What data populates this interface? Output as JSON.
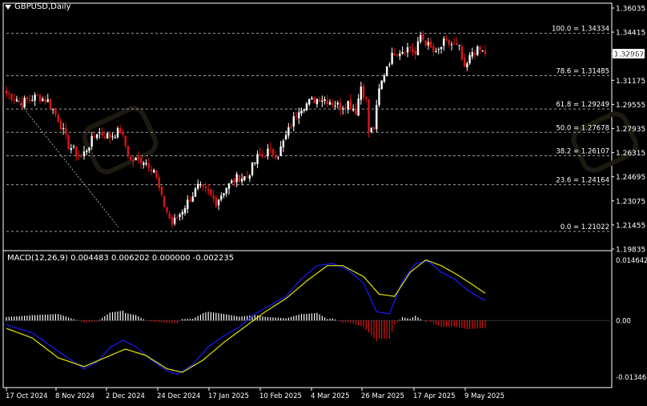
{
  "window": {
    "title": "GBPUSD,Daily"
  },
  "colors": {
    "background": "#000000",
    "bull_candle": "#ffffff",
    "bear_candle": "#e01515",
    "macd_hist_pos": "#ffffff",
    "macd_hist_neg": "#e01515",
    "macd_line": "#1a1aff",
    "signal_line": "#e5e500",
    "fib_line": "#a0a0a0",
    "axis_text": "#ffffff",
    "price_tag_bg": "#ffffff",
    "price_tag_text": "#000000"
  },
  "price_axis": {
    "labels": [
      "1.36035",
      "1.34415",
      "1.32967",
      "1.31175",
      "1.29555",
      "1.27935",
      "1.26315",
      "1.24695",
      "1.23075",
      "1.21455",
      "1.19835"
    ],
    "current_price": "1.32967"
  },
  "fibonacci": {
    "levels": [
      {
        "label": "100.0 = 1.34334",
        "price": 1.34334
      },
      {
        "label": "78.6 = 1.31485",
        "price": 1.31485
      },
      {
        "label": "61.8 = 1.29249",
        "price": 1.29249
      },
      {
        "label": "50.0 = 1.27678",
        "price": 1.27678
      },
      {
        "label": "38.2 = 1.26107",
        "price": 1.26107
      },
      {
        "label": "23.6 = 1.24164",
        "price": 1.24164
      },
      {
        "label": "0.0 = 1.21022",
        "price": 1.21022
      }
    ]
  },
  "macd": {
    "title": "MACD(12,26,9) 0.004483 0.006202 0.000000 -0.002235",
    "axis_labels": [
      "0.014642",
      "0.00",
      "-0.013461"
    ]
  },
  "time_axis": {
    "labels": [
      "17 Oct 2024",
      "8 Nov 2024",
      "2 Dec 2024",
      "24 Dec 2024",
      "17 Jan 2025",
      "10 Feb 2025",
      "4 Mar 2025",
      "26 Mar 2025",
      "17 Apr 2025",
      "9 May 2025"
    ]
  },
  "chart_data": {
    "type": "candlestick",
    "symbol": "GBPUSD",
    "timeframe": "Daily",
    "ylim": [
      1.19835,
      1.36035
    ],
    "close_anchors": [
      [
        0,
        1.303
      ],
      [
        6,
        1.297
      ],
      [
        12,
        1.301
      ],
      [
        16,
        1.298
      ],
      [
        20,
        1.286
      ],
      [
        24,
        1.268
      ],
      [
        29,
        1.26
      ],
      [
        35,
        1.277
      ],
      [
        40,
        1.274
      ],
      [
        44,
        1.278
      ],
      [
        48,
        1.258
      ],
      [
        53,
        1.258
      ],
      [
        57,
        1.252
      ],
      [
        60,
        1.232
      ],
      [
        64,
        1.215
      ],
      [
        67,
        1.222
      ],
      [
        70,
        1.23
      ],
      [
        74,
        1.24
      ],
      [
        78,
        1.236
      ],
      [
        81,
        1.23
      ],
      [
        85,
        1.24
      ],
      [
        89,
        1.246
      ],
      [
        93,
        1.247
      ],
      [
        97,
        1.26
      ],
      [
        101,
        1.264
      ],
      [
        105,
        1.262
      ],
      [
        109,
        1.278
      ],
      [
        113,
        1.293
      ],
      [
        117,
        1.297
      ],
      [
        121,
        1.3
      ],
      [
        125,
        1.298
      ],
      [
        129,
        1.294
      ],
      [
        132,
        1.297
      ],
      [
        135,
        1.291
      ],
      [
        137,
        1.308
      ],
      [
        139,
        1.298
      ],
      [
        140,
        1.277
      ],
      [
        142,
        1.28
      ],
      [
        144,
        1.305
      ],
      [
        147,
        1.322
      ],
      [
        150,
        1.331
      ],
      [
        153,
        1.332
      ],
      [
        156,
        1.334
      ],
      [
        158,
        1.329
      ],
      [
        160,
        1.342
      ],
      [
        163,
        1.335
      ],
      [
        166,
        1.329
      ],
      [
        169,
        1.337
      ],
      [
        172,
        1.336
      ],
      [
        175,
        1.333
      ],
      [
        177,
        1.318
      ],
      [
        180,
        1.331
      ],
      [
        183,
        1.332
      ],
      [
        185,
        1.33
      ]
    ],
    "macd_line_anchors": [
      [
        0,
        -0.001
      ],
      [
        10,
        -0.0028
      ],
      [
        20,
        -0.007
      ],
      [
        30,
        -0.011
      ],
      [
        35,
        -0.0095
      ],
      [
        40,
        -0.0062
      ],
      [
        45,
        -0.0045
      ],
      [
        50,
        -0.006
      ],
      [
        56,
        -0.009
      ],
      [
        62,
        -0.0115
      ],
      [
        66,
        -0.0122
      ],
      [
        72,
        -0.01
      ],
      [
        78,
        -0.006
      ],
      [
        84,
        -0.0035
      ],
      [
        90,
        -0.0015
      ],
      [
        96,
        0.0015
      ],
      [
        102,
        0.0035
      ],
      [
        108,
        0.0055
      ],
      [
        114,
        0.0095
      ],
      [
        120,
        0.0125
      ],
      [
        126,
        0.013
      ],
      [
        132,
        0.0115
      ],
      [
        138,
        0.0085
      ],
      [
        143,
        0.002
      ],
      [
        148,
        0.0015
      ],
      [
        153,
        0.009
      ],
      [
        158,
        0.013
      ],
      [
        163,
        0.0135
      ],
      [
        168,
        0.011
      ],
      [
        173,
        0.0095
      ],
      [
        178,
        0.007
      ],
      [
        185,
        0.0045
      ]
    ],
    "signal_line_anchors": [
      [
        0,
        -0.0018
      ],
      [
        10,
        -0.004
      ],
      [
        20,
        -0.0085
      ],
      [
        30,
        -0.0105
      ],
      [
        38,
        -0.0085
      ],
      [
        46,
        -0.0065
      ],
      [
        54,
        -0.008
      ],
      [
        62,
        -0.011
      ],
      [
        68,
        -0.0118
      ],
      [
        76,
        -0.009
      ],
      [
        84,
        -0.005
      ],
      [
        92,
        -0.0015
      ],
      [
        100,
        0.002
      ],
      [
        108,
        0.005
      ],
      [
        116,
        0.009
      ],
      [
        124,
        0.0125
      ],
      [
        130,
        0.0125
      ],
      [
        138,
        0.01
      ],
      [
        144,
        0.006
      ],
      [
        150,
        0.0055
      ],
      [
        156,
        0.011
      ],
      [
        162,
        0.0138
      ],
      [
        168,
        0.0125
      ],
      [
        174,
        0.0105
      ],
      [
        180,
        0.0082
      ],
      [
        185,
        0.0062
      ]
    ],
    "n_bars": 186,
    "macd_ylim": [
      -0.013461,
      0.014642
    ]
  }
}
